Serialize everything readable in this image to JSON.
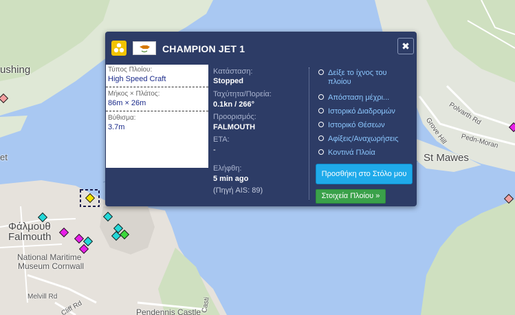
{
  "map": {
    "labels": {
      "falmouth_greek": "Φάλμουθ",
      "falmouth": "Falmouth",
      "museum_line1": "National Maritime",
      "museum_line2": "Museum Cornwall",
      "melvill_rd": "Melvill Rd",
      "cliff_rd": "Cliff Rd",
      "pendennis": "Pendennis Castle",
      "st_mawes": "St Mawes",
      "polvarth_rd": "Polvarth Rd",
      "pedn_moran": "Pedn-Moran",
      "grove_hill": "Grove Hill",
      "fishing_partial": "ushing",
      "et_partial": "et",
      "casti_partial": "Casti"
    }
  },
  "popup": {
    "title": "CHAMPION JET 1",
    "ship_icon": "speed-craft-icon",
    "flag": "cyprus-flag",
    "close_symbol": "✖",
    "specs": {
      "type_label": "Τύπος Πλοίου:",
      "type_value": "High Speed Craft",
      "dims_label": "Μήκος × Πλάτος:",
      "dims_value": "86m × 26m",
      "draught_label": "Βύθισμα:",
      "draught_value": "3.7m"
    },
    "status": {
      "status_label": "Κατάσταση:",
      "status_value": "Stopped",
      "speed_label": "Ταχύτητα/Πορεία:",
      "speed_value": "0.1kn / 266°",
      "dest_label": "Προορισμός:",
      "dest_value": "FALMOUTH",
      "eta_label": "ETA:",
      "eta_value": "-",
      "received_label": "Ελήφθη:",
      "received_value": "5 min ago",
      "source_value": "(Πηγή AIS: 89)"
    },
    "links": [
      {
        "line1": "Δείξε το ίχνος του",
        "line2": "πλοίου"
      },
      {
        "line1": "Απόσταση μέχρι...",
        "line2": ""
      },
      {
        "line1": "Ιστορικό Διαδρομών",
        "line2": ""
      },
      {
        "line1": "Ιστορικό Θέσεων",
        "line2": ""
      },
      {
        "line1": "Αφίξεις/Αναχωρήσεις",
        "line2": ""
      },
      {
        "line1": "Κοντινά Πλοία",
        "line2": ""
      }
    ],
    "fleet_button": "Προσθήκη στο Στόλο μου",
    "details_button": "Στοιχεία Πλοίου »"
  }
}
